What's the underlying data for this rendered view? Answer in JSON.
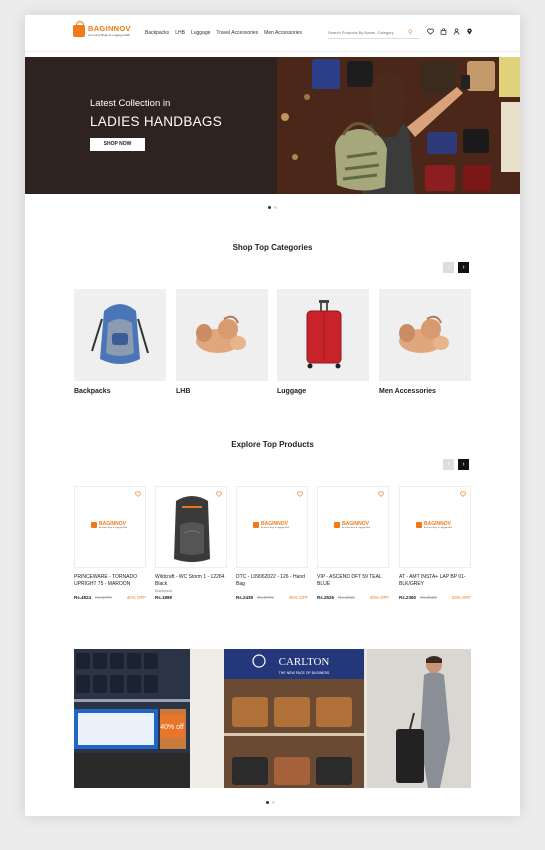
{
  "brand": {
    "name": "BAGINNOV",
    "tagline": "An Iconic Bags & Luggage Mall"
  },
  "nav": [
    "Backpacks",
    "LHB",
    "Luggage",
    "Travel Accessories",
    "Men Accessories"
  ],
  "search": {
    "placeholder": "Search Products By Name, Category"
  },
  "hero": {
    "subtitle": "Latest Collection in",
    "title": "LADIES HANDBAGS",
    "cta": "SHOP NOW"
  },
  "categories": {
    "title": "Shop Top Categories",
    "items": [
      "Backpacks",
      "LHB",
      "Luggage",
      "Men Accessories"
    ]
  },
  "products": {
    "title": "Explore Top Products",
    "items": [
      {
        "name": "PRINCEWARE - TORNADO UPRIGHT 75 - MAROON",
        "brand": "",
        "price": "Rs.4824",
        "mrp": "Rs.6770",
        "off": "40% OFF"
      },
      {
        "name": "Wildcraft - WC Storm 1 - 12264 Black",
        "brand": "Backpack",
        "price": "Rs.1899",
        "mrp": "",
        "off": ""
      },
      {
        "name": "DTC - L09062022 - 126 - Hand Bag",
        "brand": "",
        "price": "Rs.2439",
        "mrp": "Rs.3770",
        "off": "45% OFF"
      },
      {
        "name": "VIP - ASCEND DFT 59 TEAL BLUE",
        "brand": "",
        "price": "Rs.2526",
        "mrp": "Rs.4210",
        "off": "40% OFF"
      },
      {
        "name": "AT - AMT INSTA+ LAP BP 01- BLK/GREY",
        "brand": "",
        "price": "Rs.2360",
        "mrp": "Rs.3550",
        "off": "33% OFF"
      }
    ]
  },
  "promo": {
    "store": "CARLTON",
    "store_tag": "THE NEW FACE OF BUSINESS",
    "offer": "40% off"
  },
  "colors": {
    "accent": "#f07a1a",
    "hero_bg": "#2e231f",
    "tile_bg": "#efefef"
  }
}
